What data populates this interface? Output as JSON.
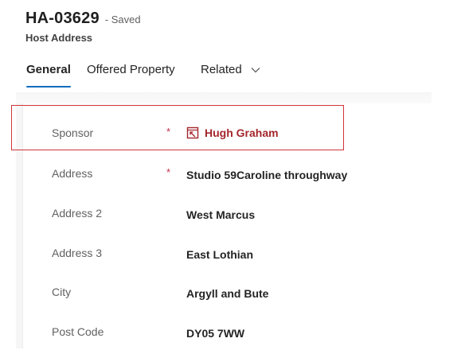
{
  "record": {
    "id": "HA-03629",
    "status": "- Saved",
    "entity": "Host Address"
  },
  "tabs": [
    {
      "label": "General",
      "active": true
    },
    {
      "label": "Offered Property",
      "active": false
    },
    {
      "label": "Related",
      "active": false,
      "has_dropdown": true
    }
  ],
  "fields": [
    {
      "label": "Sponsor",
      "required": "*",
      "value": "Hugh Graham",
      "type": "lookup",
      "icon": "lookup-record-icon"
    },
    {
      "label": "Address",
      "required": "*",
      "value": "Studio 59Caroline throughway"
    },
    {
      "label": "Address 2",
      "value": "West Marcus"
    },
    {
      "label": "Address 3",
      "value": "East Lothian"
    },
    {
      "label": "City",
      "value": "Argyll and Bute"
    },
    {
      "label": "Post Code",
      "value": "DY05 7WW"
    }
  ],
  "colors": {
    "accent": "#0f6cbd",
    "required": "#c4314b",
    "lookup_link": "#a4262c",
    "highlight_border": "#d13438"
  }
}
